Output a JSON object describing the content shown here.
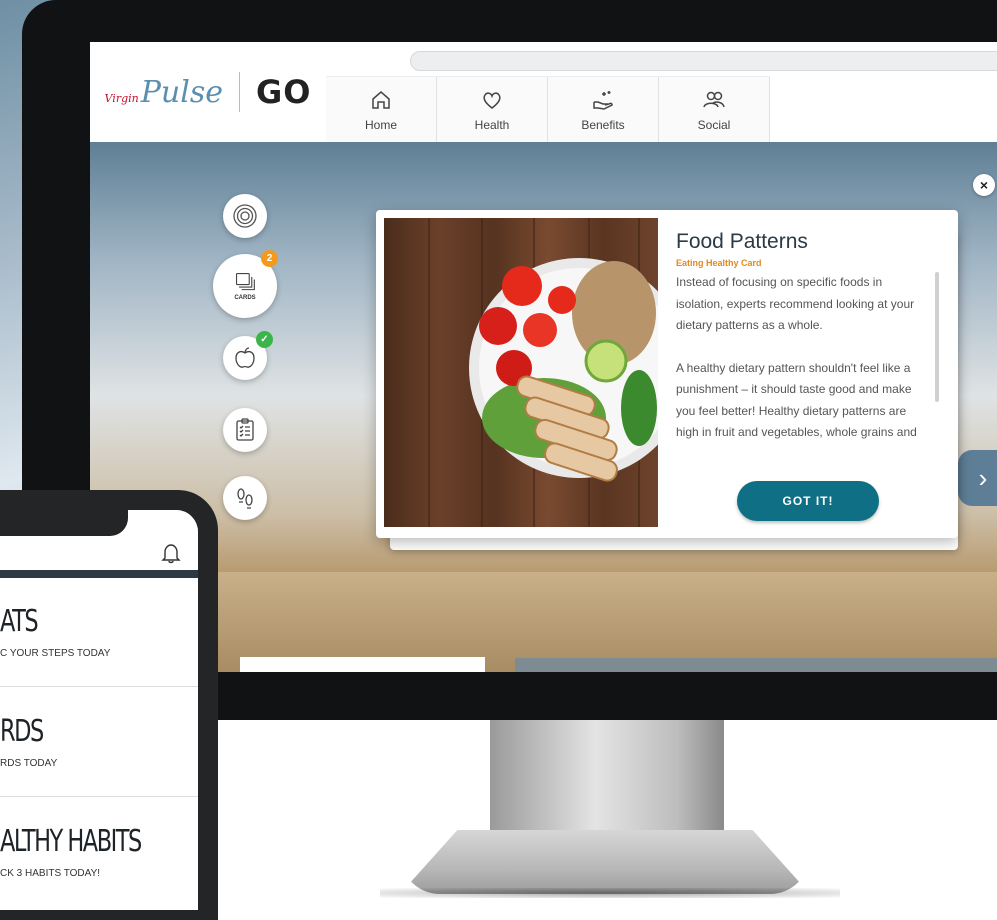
{
  "header": {
    "logo_virgin": "Virgin",
    "logo_pulse": "Pulse",
    "logo_go": "GO"
  },
  "nav": {
    "items": [
      {
        "label": "Home",
        "icon": "home-icon"
      },
      {
        "label": "Health",
        "icon": "heart-icon"
      },
      {
        "label": "Benefits",
        "icon": "hand-sparkle-icon"
      },
      {
        "label": "Social",
        "icon": "people-icon"
      }
    ]
  },
  "rail": {
    "cards_label": "CARDS",
    "cards_badge": "2",
    "badge_orange": "#f39a1e",
    "badge_green": "#3bb54a"
  },
  "card": {
    "title": "Food Patterns",
    "subtitle": "Eating Healthy Card",
    "paragraphs": [
      "Instead of focusing on specific foods in isolation, experts recommend looking at your dietary patterns as a whole.",
      "A healthy dietary pattern shouldn't feel like a punishment – it should taste good and make you feel better! Healthy dietary patterns are high in fruit and vegetables, whole grains and"
    ],
    "button": "GOT IT!",
    "close": "×",
    "next": "›",
    "accent": "#0f6f84"
  },
  "phone": {
    "rows": [
      {
        "title": "ATS",
        "sub": "C YOUR STEPS TODAY"
      },
      {
        "title": "RDS",
        "sub": "RDS TODAY"
      },
      {
        "title": "ALTHY HABITS",
        "sub": "CK 3 HABITS TODAY!"
      }
    ]
  }
}
